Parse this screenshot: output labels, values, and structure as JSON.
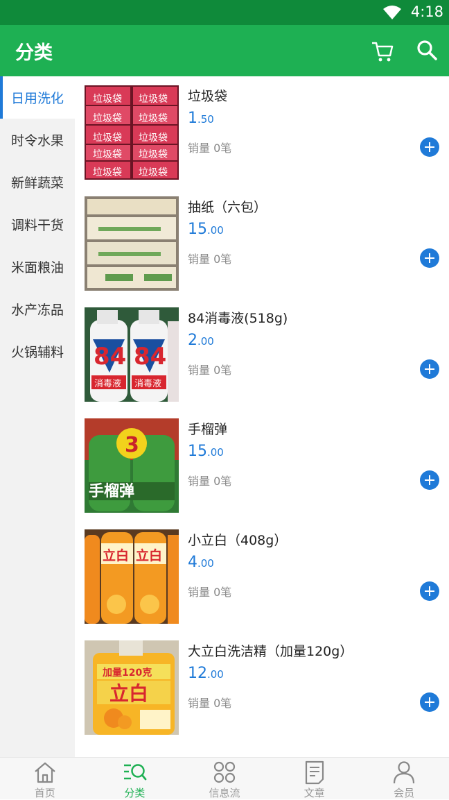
{
  "status": {
    "time": "4:18"
  },
  "header": {
    "title": "分类"
  },
  "sidebar": {
    "items": [
      {
        "label": "日用洗化",
        "active": true
      },
      {
        "label": "时令水果"
      },
      {
        "label": "新鲜蔬菜"
      },
      {
        "label": "调料干货"
      },
      {
        "label": "米面粮油"
      },
      {
        "label": "水产冻品"
      },
      {
        "label": "火锅辅料"
      }
    ]
  },
  "products": [
    {
      "name": "垃圾袋",
      "price_int": "1",
      "price_dec": ".50",
      "sales": "销量 0笔"
    },
    {
      "name": "抽纸（六包）",
      "price_int": "15",
      "price_dec": ".00",
      "sales": "销量 0笔"
    },
    {
      "name": "84消毒液(518g)",
      "price_int": "2",
      "price_dec": ".00",
      "sales": "销量 0笔"
    },
    {
      "name": "手榴弹",
      "price_int": "15",
      "price_dec": ".00",
      "sales": "销量 0笔"
    },
    {
      "name": "小立白（408g）",
      "price_int": "4",
      "price_dec": ".00",
      "sales": "销量 0笔"
    },
    {
      "name": "大立白洗洁精（加量120g）",
      "price_int": "12",
      "price_dec": ".00",
      "sales": "销量 0笔"
    }
  ],
  "thumbs": {
    "p1_text": "垃圾袋",
    "p3_text": "84",
    "p3_sub": "消毒液",
    "p4_badge": "3",
    "p4_text": "手榴弹",
    "p5_text": "立白",
    "p6_top": "加量120克",
    "p6_text": "立白"
  },
  "tabbar": {
    "items": [
      {
        "label": "首页"
      },
      {
        "label": "分类",
        "active": true
      },
      {
        "label": "信息流"
      },
      {
        "label": "文章"
      },
      {
        "label": "会员"
      }
    ]
  },
  "colors": {
    "primary": "#1eb053",
    "status": "#0f8a3a",
    "accent": "#1f7ad8"
  },
  "icons": [
    "wifi-icon",
    "cart-icon",
    "search-icon",
    "plus-icon",
    "home-icon",
    "category-icon",
    "feed-icon",
    "article-icon",
    "member-icon"
  ]
}
